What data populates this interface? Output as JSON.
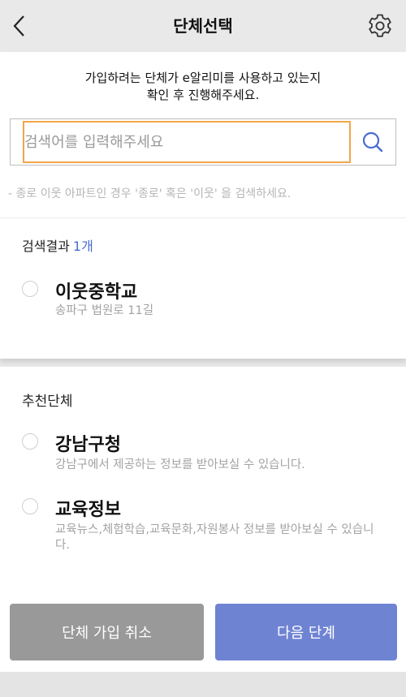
{
  "header": {
    "title": "단체선택",
    "back_icon": "chevron-left-icon",
    "settings_icon": "gear-icon"
  },
  "notice": {
    "line1": "가입하려는 단체가 e알리미를 사용하고 있는지",
    "line2": "확인 후 진행해주세요."
  },
  "search": {
    "placeholder": "검색어를 입력해주세요",
    "value": "",
    "button_icon": "search-icon"
  },
  "hint": "- 종로 이웃 아파트인 경우 '종로' 혹은 '이웃' 을 검색하세요.",
  "results": {
    "label": "검색결과",
    "count": "1개",
    "items": [
      {
        "title": "이웃중학교",
        "subtitle": "송파구 법원로 11길"
      }
    ]
  },
  "recommended": {
    "label": "추천단체",
    "items": [
      {
        "title": "강남구청",
        "subtitle": "강남구에서 제공하는 정보를 받아보실 수 있습니다."
      },
      {
        "title": "교육정보",
        "subtitle": "교육뉴스,체험학습,교육문화,자원봉사 정보를 받아보실 수 있습니다."
      }
    ]
  },
  "buttons": {
    "cancel": "단체 가입 취소",
    "next": "다음 단계"
  },
  "colors": {
    "accent": "#4a6bd4",
    "next_button": "#6f83d3",
    "cancel_button": "#999999",
    "input_focus": "#f0a64a"
  }
}
